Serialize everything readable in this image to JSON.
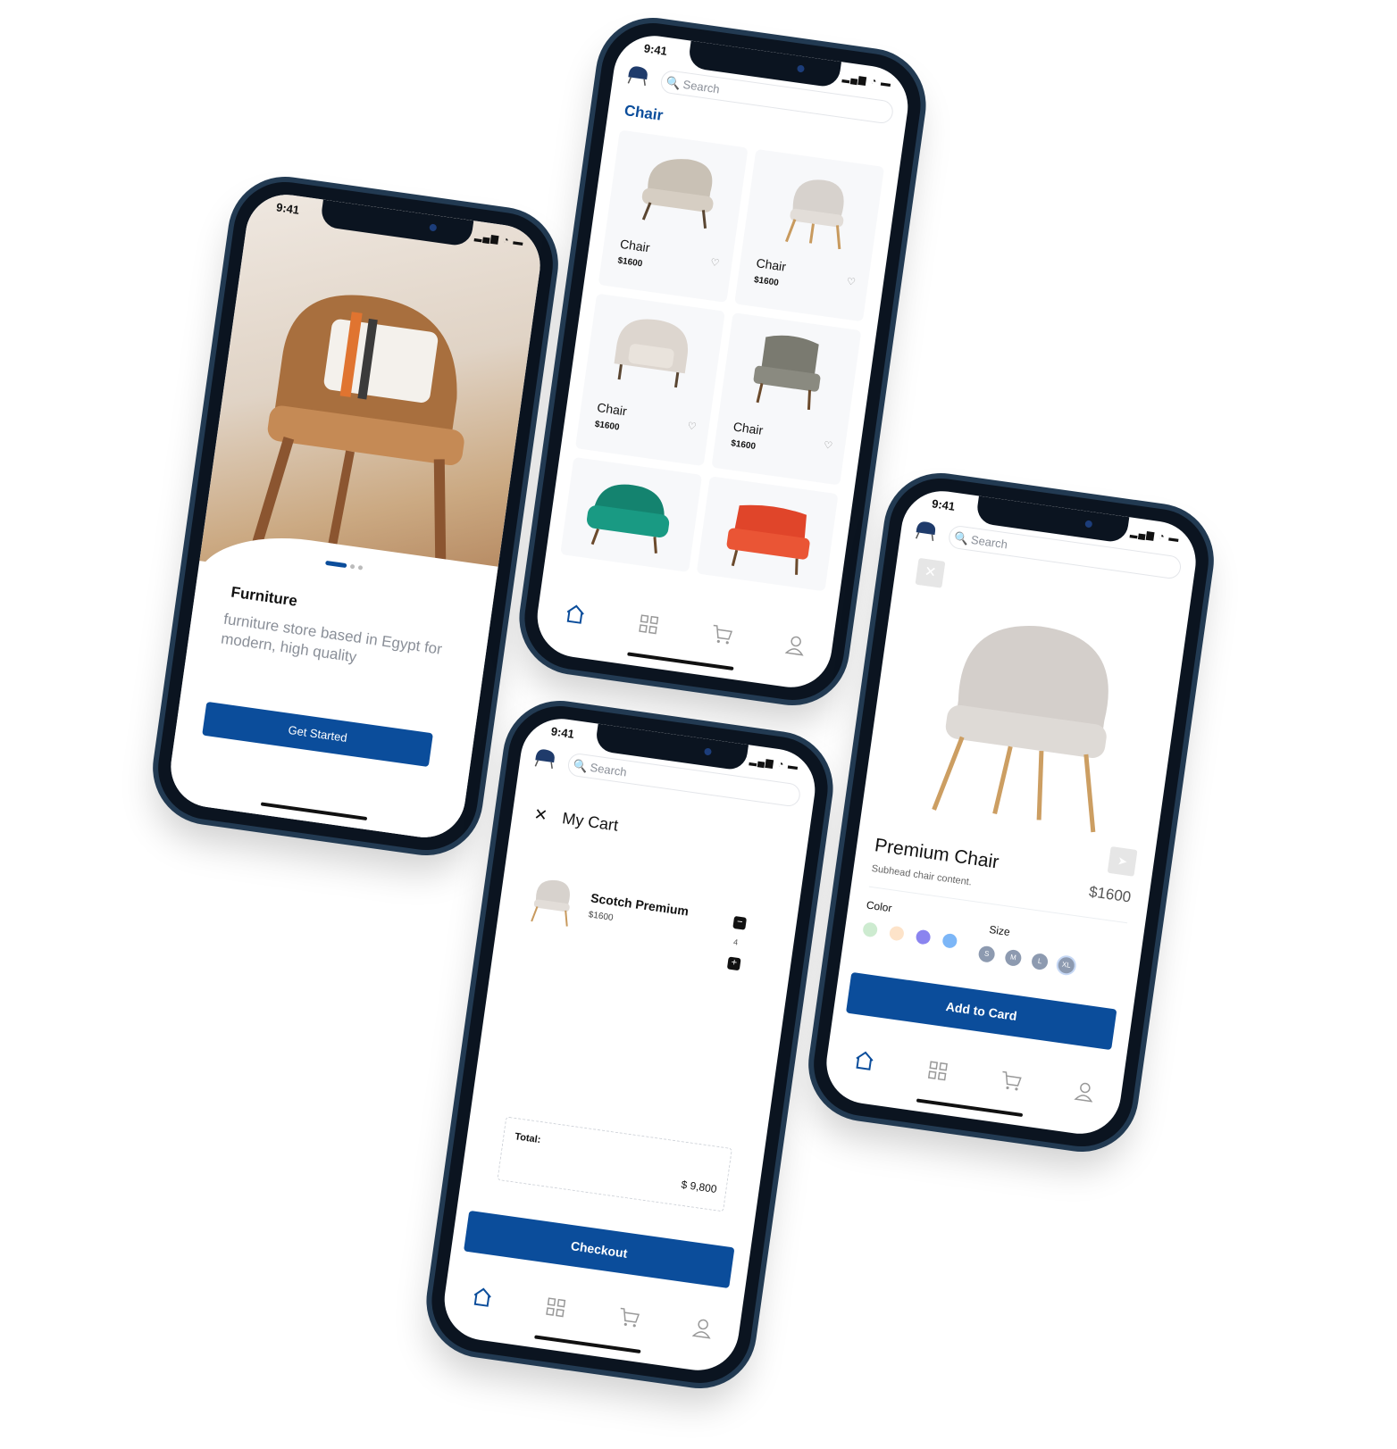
{
  "status": {
    "time": "9:41"
  },
  "search": {
    "placeholder": "Search"
  },
  "onboarding": {
    "title": "Furniture",
    "description": "furniture store based in Egypt for modern, high quality",
    "cta": "Get Started"
  },
  "catalog": {
    "heading": "Chair",
    "products": [
      {
        "name": "Chair",
        "price": "$1600"
      },
      {
        "name": "Chair",
        "price": "$1600"
      },
      {
        "name": "Chair",
        "price": "$1600"
      },
      {
        "name": "Chair",
        "price": "$1600"
      }
    ]
  },
  "cart": {
    "title": "My Cart",
    "item": {
      "name": "Scotch Premium",
      "price": "$1600",
      "qty": "4"
    },
    "total_label": "Total:",
    "total_value": "$ 9,800",
    "checkout": "Checkout"
  },
  "detail": {
    "name": "Premium Chair",
    "subhead": "Subhead chair content.",
    "price": "$1600",
    "color_label": "Color",
    "size_label": "Size",
    "colors": [
      "#cdebd0",
      "#fde3c9",
      "#8a84ef",
      "#7cb6f7"
    ],
    "sizes": [
      "S",
      "M",
      "L",
      "XL"
    ],
    "cta": "Add to Card"
  },
  "colors": {
    "primary": "#0b4d9b",
    "frame": "#0b1420"
  }
}
